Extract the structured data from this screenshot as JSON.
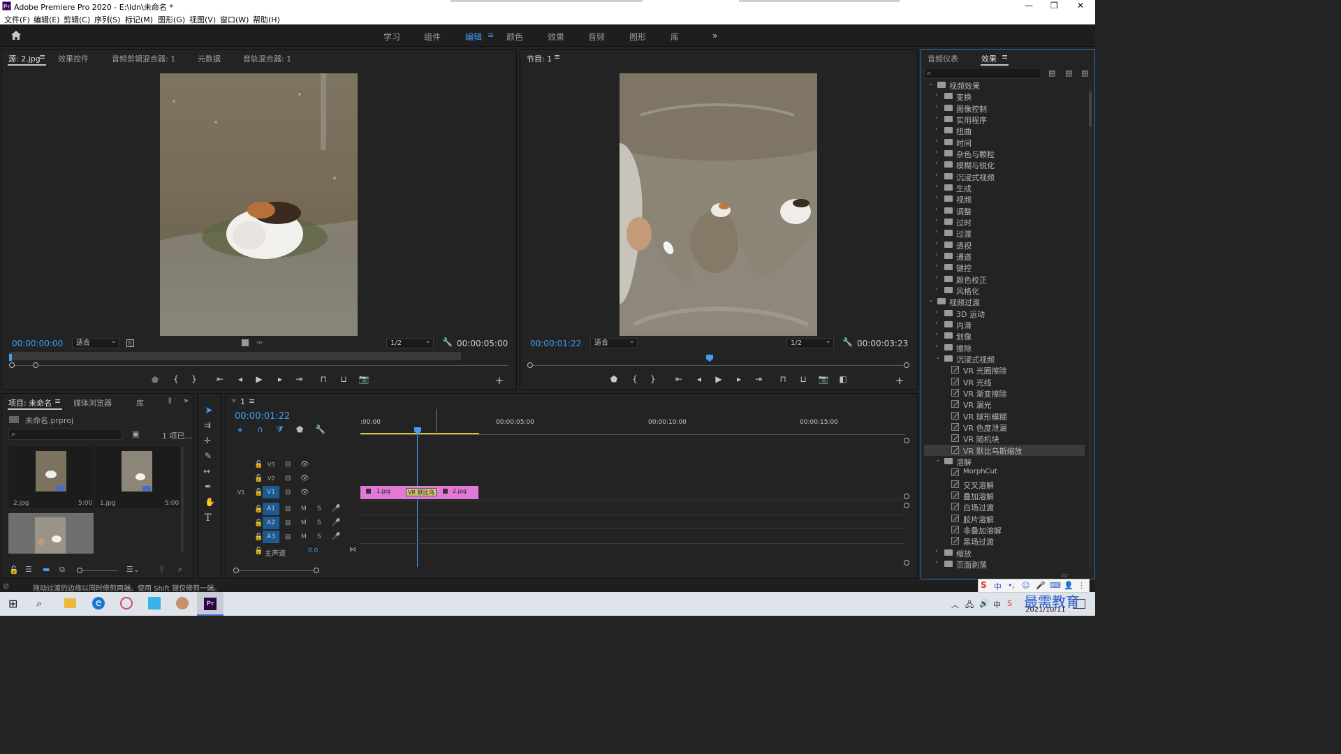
{
  "window": {
    "title": "Adobe Premiere Pro 2020 - E:\\ldn\\未命名 *",
    "app_icon": "Pr"
  },
  "menu": [
    "文件(F)",
    "编辑(E)",
    "剪辑(C)",
    "序列(S)",
    "标记(M)",
    "图形(G)",
    "视图(V)",
    "窗口(W)",
    "帮助(H)"
  ],
  "workspaces": [
    {
      "label": "学习"
    },
    {
      "label": "组件"
    },
    {
      "label": "编辑",
      "active": true
    },
    {
      "label": "颜色"
    },
    {
      "label": "效果"
    },
    {
      "label": "音频"
    },
    {
      "label": "图形"
    },
    {
      "label": "库"
    }
  ],
  "source_panel": {
    "tabs": [
      "源: 2.jpg",
      "效果控件",
      "音频剪辑混合器: 1",
      "元数据",
      "音轨混合器: 1"
    ],
    "timecode": "00:00:00:00",
    "fit": "适合",
    "resolution": "1/2",
    "duration": "00:00:05:00"
  },
  "program_panel": {
    "tab": "节目: 1",
    "timecode": "00:00:01:22",
    "fit": "适合",
    "resolution": "1/2",
    "duration": "00:00:03:23"
  },
  "project_panel": {
    "tabs": [
      "项目: 未命名",
      "媒体浏览器",
      "库"
    ],
    "file": "未命名.prproj",
    "count": "1 项已...",
    "items": [
      {
        "name": "2.jpg",
        "duration": "5:00"
      },
      {
        "name": "1.jpg",
        "duration": "5:00"
      }
    ]
  },
  "timeline": {
    "tab": "1",
    "timecode": "00:00:01:22",
    "ruler": [
      ":00:00",
      "00:00:05:00",
      "00:00:10:00",
      "00:00:15:00"
    ],
    "video_tracks": [
      "V3",
      "V2",
      "V1"
    ],
    "audio_tracks": [
      "A1",
      "A2",
      "A3"
    ],
    "source_patch": "V1",
    "track_buttons": {
      "mute": "M",
      "solo": "S"
    },
    "master_label": "主声道",
    "master_value": "0.0",
    "clips": [
      {
        "name": "1.jpg"
      },
      {
        "name": "VR 默比乌"
      },
      {
        "name": "2.jpg"
      }
    ]
  },
  "effects_panel": {
    "tabs": [
      "音频仪表",
      "效果"
    ],
    "tree": [
      {
        "label": "视频效果",
        "level": 0,
        "open": true,
        "type": "folder"
      },
      {
        "label": "变换",
        "level": 1,
        "type": "folder"
      },
      {
        "label": "图像控制",
        "level": 1,
        "type": "folder"
      },
      {
        "label": "实用程序",
        "level": 1,
        "type": "folder"
      },
      {
        "label": "扭曲",
        "level": 1,
        "type": "folder"
      },
      {
        "label": "时间",
        "level": 1,
        "type": "folder"
      },
      {
        "label": "杂色与颗粒",
        "level": 1,
        "type": "folder"
      },
      {
        "label": "模糊与锐化",
        "level": 1,
        "type": "folder"
      },
      {
        "label": "沉浸式视频",
        "level": 1,
        "type": "folder"
      },
      {
        "label": "生成",
        "level": 1,
        "type": "folder"
      },
      {
        "label": "视频",
        "level": 1,
        "type": "folder"
      },
      {
        "label": "调整",
        "level": 1,
        "type": "folder"
      },
      {
        "label": "过时",
        "level": 1,
        "type": "folder"
      },
      {
        "label": "过渡",
        "level": 1,
        "type": "folder"
      },
      {
        "label": "透视",
        "level": 1,
        "type": "folder"
      },
      {
        "label": "通道",
        "level": 1,
        "type": "folder"
      },
      {
        "label": "键控",
        "level": 1,
        "type": "folder"
      },
      {
        "label": "颜色校正",
        "level": 1,
        "type": "folder"
      },
      {
        "label": "风格化",
        "level": 1,
        "type": "folder"
      },
      {
        "label": "视频过渡",
        "level": 0,
        "open": true,
        "type": "folder"
      },
      {
        "label": "3D 运动",
        "level": 1,
        "type": "folder"
      },
      {
        "label": "内滑",
        "level": 1,
        "type": "folder"
      },
      {
        "label": "划像",
        "level": 1,
        "type": "folder"
      },
      {
        "label": "擦除",
        "level": 1,
        "type": "folder"
      },
      {
        "label": "沉浸式视频",
        "level": 1,
        "open": true,
        "type": "folder"
      },
      {
        "label": "VR 光圈擦除",
        "level": 2,
        "type": "fx"
      },
      {
        "label": "VR 光线",
        "level": 2,
        "type": "fx"
      },
      {
        "label": "VR 渐变擦除",
        "level": 2,
        "type": "fx"
      },
      {
        "label": "VR 漏光",
        "level": 2,
        "type": "fx"
      },
      {
        "label": "VR 球形模糊",
        "level": 2,
        "type": "fx"
      },
      {
        "label": "VR 色度泄漏",
        "level": 2,
        "type": "fx"
      },
      {
        "label": "VR 随机块",
        "level": 2,
        "type": "fx"
      },
      {
        "label": "VR 默比乌斯缩放",
        "level": 2,
        "type": "fx",
        "selected": true
      },
      {
        "label": "溶解",
        "level": 1,
        "open": true,
        "type": "folder"
      },
      {
        "label": "MorphCut",
        "level": 2,
        "type": "fx"
      },
      {
        "label": "交叉溶解",
        "level": 2,
        "type": "fx"
      },
      {
        "label": "叠加溶解",
        "level": 2,
        "type": "fx"
      },
      {
        "label": "白场过渡",
        "level": 2,
        "type": "fx"
      },
      {
        "label": "胶片溶解",
        "level": 2,
        "type": "fx"
      },
      {
        "label": "非叠加溶解",
        "level": 2,
        "type": "fx"
      },
      {
        "label": "黑场过渡",
        "level": 2,
        "type": "fx"
      },
      {
        "label": "缩放",
        "level": 1,
        "type": "folder"
      },
      {
        "label": "页面剥落",
        "level": 1,
        "type": "folder"
      }
    ]
  },
  "status_bar": "拖动过渡的边缘以同时修剪两端。使用 Shift 键仅修剪一端。",
  "taskbar": {
    "date": "2021/10/11",
    "watermark": "最需教育"
  },
  "colors": {
    "accent": "#3f9ef7",
    "clip": "#e07ad6",
    "work_area": "#d8c43a",
    "track_target": "#1e5a8e"
  }
}
